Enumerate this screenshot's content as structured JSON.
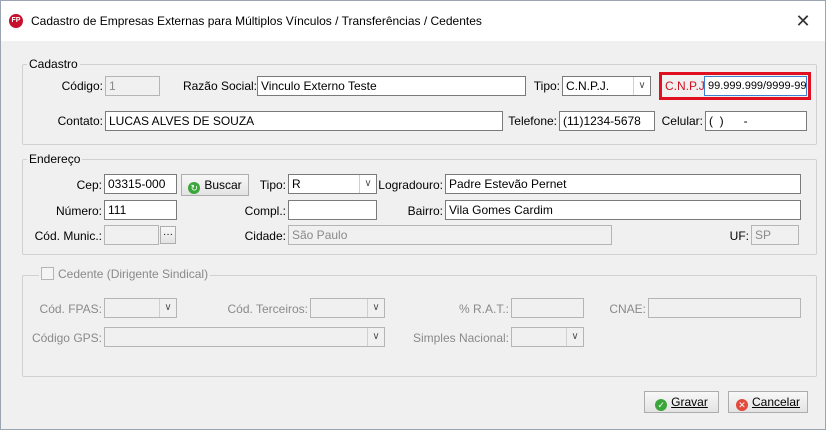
{
  "window": {
    "title": "Cadastro de Empresas Externas para Múltiplos Vínculos / Transferências / Cedentes",
    "app_icon_text": "FP",
    "close_glyph": "✕"
  },
  "cadastro": {
    "group_label": "Cadastro",
    "codigo_label": "Código:",
    "codigo_value": "1",
    "razao_label": "Razão Social:",
    "razao_value": "Vinculo Externo Teste",
    "tipo_label": "Tipo:",
    "tipo_value": "C.N.P.J.",
    "cnpj_label": "C.N.P.J.:",
    "cnpj_value": "99.999.999/9999-99",
    "contato_label": "Contato:",
    "contato_value": "LUCAS ALVES DE SOUZA",
    "telefone_label": "Telefone:",
    "telefone_value": "(11)1234-5678",
    "celular_label": "Celular:",
    "celular_value": "(  )      -"
  },
  "endereco": {
    "group_label": "Endereço",
    "cep_label": "Cep:",
    "cep_value": "03315-000",
    "buscar_label": "Buscar",
    "tipo_label": "Tipo:",
    "tipo_value": "R",
    "logradouro_label": "Logradouro:",
    "logradouro_value": "Padre Estevão Pernet",
    "numero_label": "Número:",
    "numero_value": "111",
    "compl_label": "Compl.:",
    "compl_value": "",
    "bairro_label": "Bairro:",
    "bairro_value": "Vila Gomes Cardim",
    "cod_munic_label": "Cód. Munic.:",
    "cod_munic_value": "",
    "lookup_glyph": "···",
    "cidade_label": "Cidade:",
    "cidade_value": "São Paulo",
    "uf_label": "UF:",
    "uf_value": "SP"
  },
  "cedente": {
    "group_label": "Cedente (Dirigente Sindical)",
    "cod_fpas_label": "Cód. FPAS:",
    "cod_terceiros_label": "Cód. Terceiros:",
    "rat_label": "% R.A.T.:",
    "cnae_label": "CNAE:",
    "codigo_gps_label": "Código GPS:",
    "simples_label": "Simples Nacional:"
  },
  "buttons": {
    "gravar": "Gravar",
    "cancelar": "Cancelar"
  },
  "colors": {
    "highlight": "#e01020",
    "cnpj_label": "#d01020"
  }
}
